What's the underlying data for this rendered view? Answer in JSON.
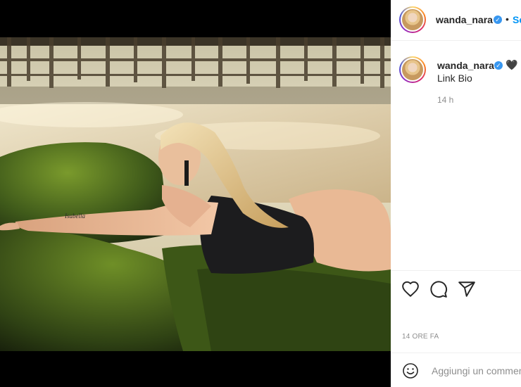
{
  "post": {
    "image_alt": "Woman in black swimsuit lying on moss-covered rock at the beach"
  },
  "header": {
    "username": "wanda_nara",
    "verified_icon": "verified-badge-icon",
    "separator": "•",
    "follow_label": "Se"
  },
  "caption": {
    "username": "wanda_nara",
    "verified_icon": "verified-badge-icon",
    "emoji": "🖤",
    "text": "Link Bio",
    "time_ago": "14 h"
  },
  "actions": {
    "like_icon": "heart-icon",
    "comment_icon": "comment-icon",
    "share_icon": "share-icon"
  },
  "post_date": "14 ORE FA",
  "comment_box": {
    "emoji_icon": "smiley-icon",
    "placeholder": "Aggiungi un commento..."
  },
  "colors": {
    "follow_blue": "#0095f6",
    "verified_blue": "#3897f0",
    "muted_text": "#8e8e8e"
  }
}
